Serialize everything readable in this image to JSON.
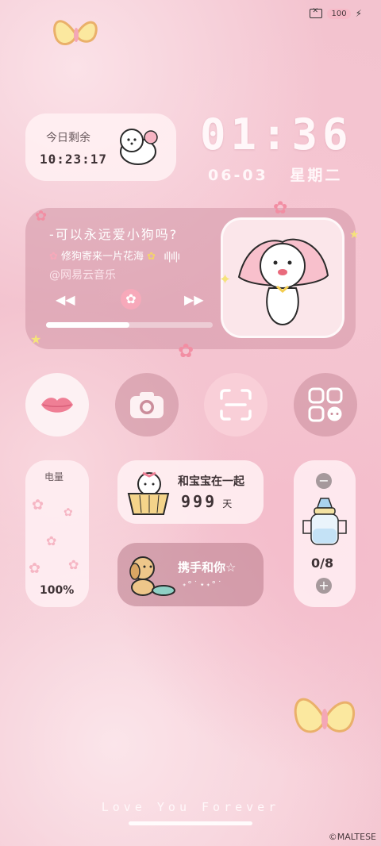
{
  "status_bar": {
    "battery": "100",
    "sim_icon": "no-sim-icon",
    "charge_icon": "lightning-icon"
  },
  "timer_widget": {
    "label": "今日剩余",
    "value": "10:23:17"
  },
  "clock": {
    "time": "01:36",
    "date": "06-03",
    "weekday": "星期二"
  },
  "music": {
    "title": "-可以永远爱小狗吗?",
    "lyric": "修狗寄来一片花海",
    "app": "@网易云音乐",
    "progress": 0.5,
    "controls": {
      "prev": "previous-icon",
      "play": "flower-play-icon",
      "next": "next-icon"
    }
  },
  "apps": [
    {
      "name": "pink-lips-app",
      "icon": "lips-icon"
    },
    {
      "name": "camera-app",
      "icon": "camera-icon"
    },
    {
      "name": "scan-app",
      "icon": "scan-icon"
    },
    {
      "name": "app-folder",
      "icon": "grid-folder-icon"
    }
  ],
  "battery_widget": {
    "label": "电量",
    "value": "100%"
  },
  "together_widget": {
    "label": "和宝宝在一起",
    "number": "999",
    "unit": "天"
  },
  "hand_widget": {
    "label": "携手和你☆",
    "deco": "˖°˙⋆˖°˙"
  },
  "bottle_widget": {
    "count": "0/8",
    "minus": "−",
    "plus": "+"
  },
  "footer": {
    "text": "Love You Forever",
    "credit": "©MALTESE"
  },
  "colors": {
    "pink_bg": "#f3c3cf",
    "card_light": "#fff0f3",
    "card_dark": "#d296a5"
  }
}
